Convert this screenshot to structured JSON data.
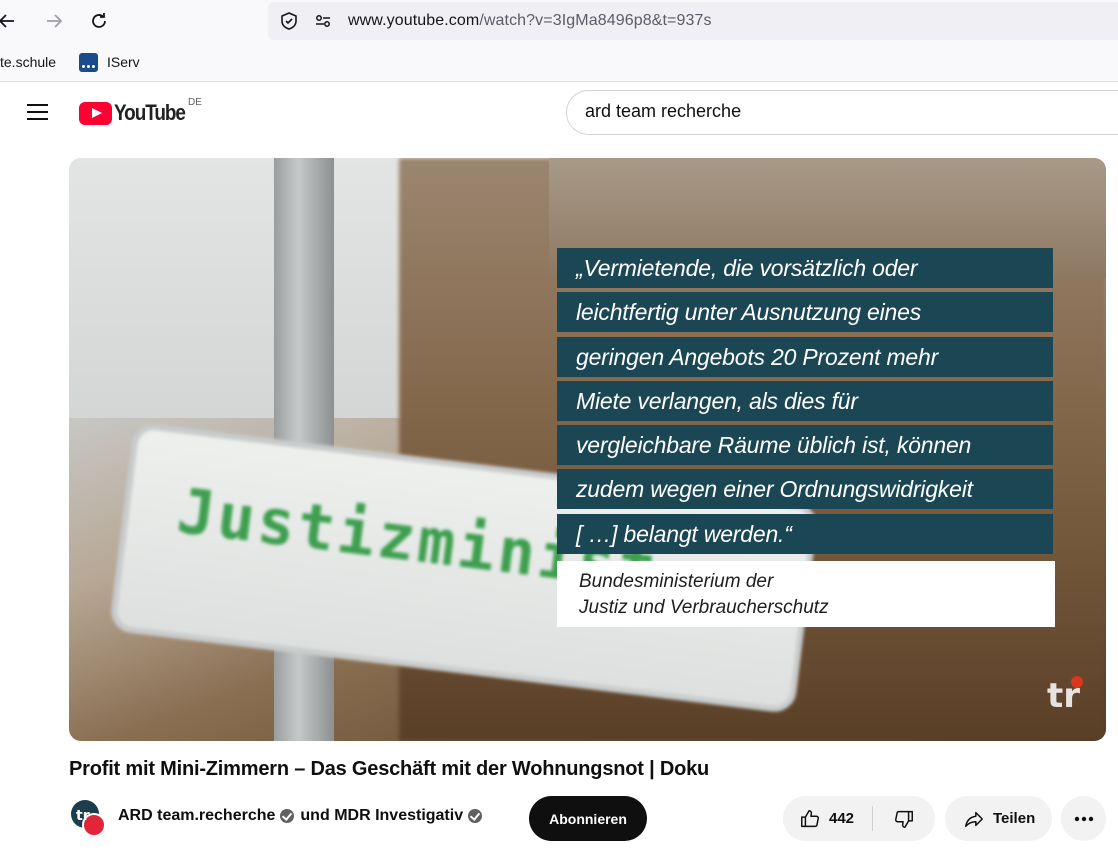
{
  "browser": {
    "url_domain": "www.youtube.com",
    "url_path": "/watch?v=3IgMa8496p8&t=937s",
    "bookmarks": [
      {
        "label": "te.schule"
      },
      {
        "label": "IServ"
      }
    ]
  },
  "youtube": {
    "logo_text": "YouTube",
    "country_code": "DE",
    "search_value": "ard team recherche"
  },
  "video": {
    "sign_text": "Justizminist",
    "quote_lines": [
      "„Vermietende, die vorsätzlich oder",
      "leichtfertig unter Ausnutzung eines",
      "geringen Angebots 20 Prozent mehr",
      "Miete verlangen, als dies für",
      "vergleichbare Räume üblich ist, können",
      "zudem wegen einer Ordnungswidrigkeit",
      "[ …] belangt werden.“"
    ],
    "source_lines": [
      "Bundesministerium der",
      "Justiz und Verbraucherschutz"
    ],
    "watermark": "tr"
  },
  "meta": {
    "title": "Profit mit Mini-Zimmern – Das Geschäft mit der Wohnungsnot | Doku",
    "channel_1": "ARD team.recherche",
    "connector": "und",
    "channel_2": "MDR Investigativ",
    "subscribe_label": "Abonnieren",
    "like_count": "442",
    "share_label": "Teilen"
  },
  "colors": {
    "youtube_red": "#ff0033",
    "quote_bg": "#1b4654"
  }
}
